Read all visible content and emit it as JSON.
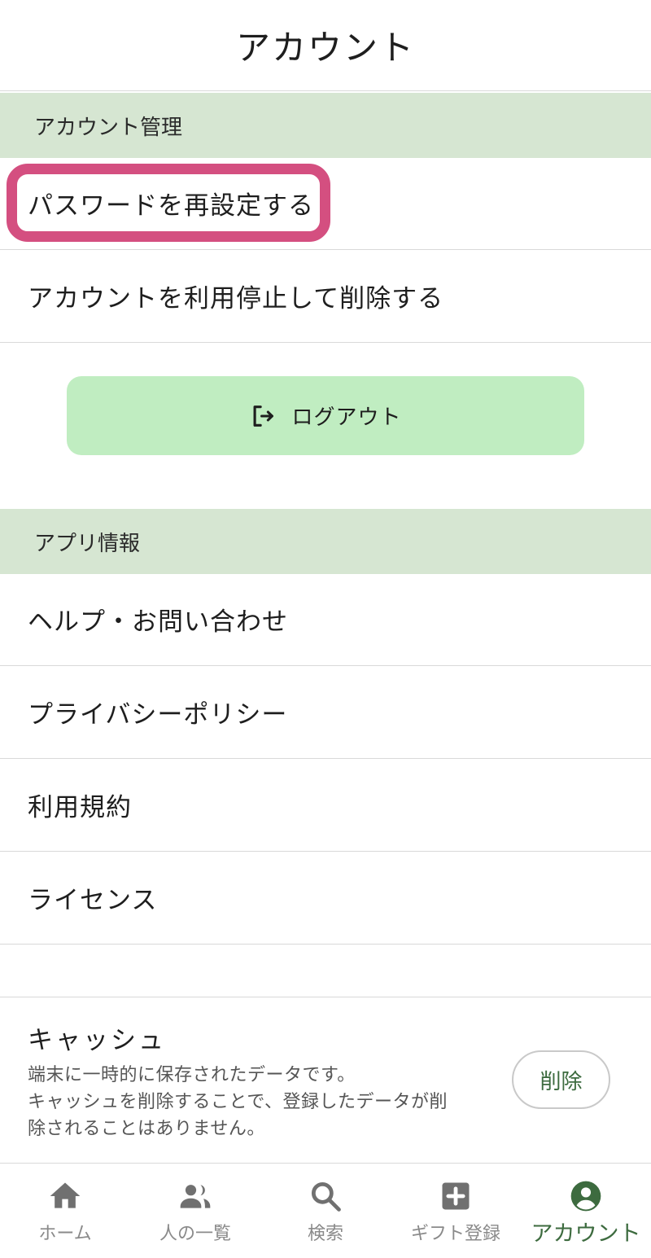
{
  "header": {
    "title": "アカウント"
  },
  "account_section": {
    "title": "アカウント管理",
    "items": [
      {
        "label": "パスワードを再設定する"
      },
      {
        "label": "アカウントを利用停止して削除する"
      }
    ],
    "logout_label": "ログアウト"
  },
  "app_section": {
    "title": "アプリ情報",
    "items": [
      {
        "label": "ヘルプ・お問い合わせ"
      },
      {
        "label": "プライバシーポリシー"
      },
      {
        "label": "利用規約"
      },
      {
        "label": "ライセンス"
      }
    ]
  },
  "cache": {
    "title": "キャッシュ",
    "desc_line1": "端末に一時的に保存されたデータです。",
    "desc_line2": "キャッシュを削除することで、登録したデータが削",
    "desc_line3": "除されることはありません。",
    "delete_label": "削除"
  },
  "tabs": [
    {
      "label": "ホーム",
      "icon": "home-icon"
    },
    {
      "label": "人の一覧",
      "icon": "people-icon"
    },
    {
      "label": "検索",
      "icon": "search-icon"
    },
    {
      "label": "ギフト登録",
      "icon": "add-box-icon"
    },
    {
      "label": "アカウント",
      "icon": "account-circle-icon",
      "active": true
    }
  ],
  "colors": {
    "section_bg": "#d6e6d2",
    "logout_bg": "#c0edc1",
    "highlight": "#d44f80",
    "accent": "#3d6b3f",
    "tab_inactive": "#8a8a8a"
  }
}
